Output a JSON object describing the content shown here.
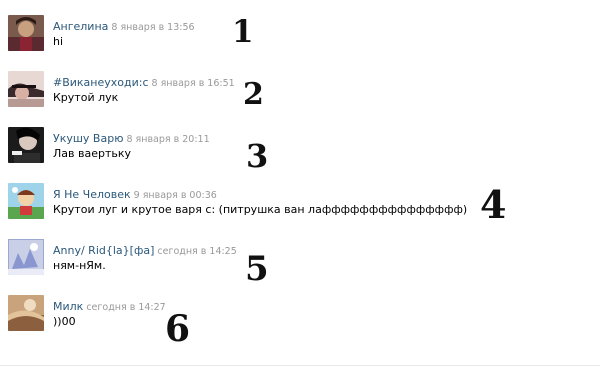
{
  "comments": [
    {
      "author": "Ангелина",
      "date": "8 января в 13:56",
      "text": "hi",
      "number": "1"
    },
    {
      "author": "#Виканеуходи:с",
      "date": "8 января в 16:51",
      "text": "Крутой лук",
      "number": "2"
    },
    {
      "author": "Укушу Варю",
      "date": "8 января в 20:11",
      "text": "Лав ваертьку",
      "number": "3"
    },
    {
      "author": "Я Не Человек",
      "date": "9 января в 00:36",
      "text": "Крутои луг и крутое варя с: (питрушка ван лаффффффффффффффф)",
      "number": "4"
    },
    {
      "author": "Anny/ Rid{la}[фа]",
      "date": "сегодня в 14:25",
      "text": "ням-нЯм.",
      "number": "5"
    },
    {
      "author": "Милк",
      "date": "сегодня в 14:27",
      "text": "))00",
      "number": "6"
    }
  ],
  "avatars": [
    "avatar-icon",
    "avatar-icon",
    "avatar-icon",
    "avatar-icon",
    "avatar-icon",
    "avatar-icon"
  ],
  "colors": {
    "author_link": "#2b587a",
    "date": "#999999",
    "text": "#000000"
  }
}
